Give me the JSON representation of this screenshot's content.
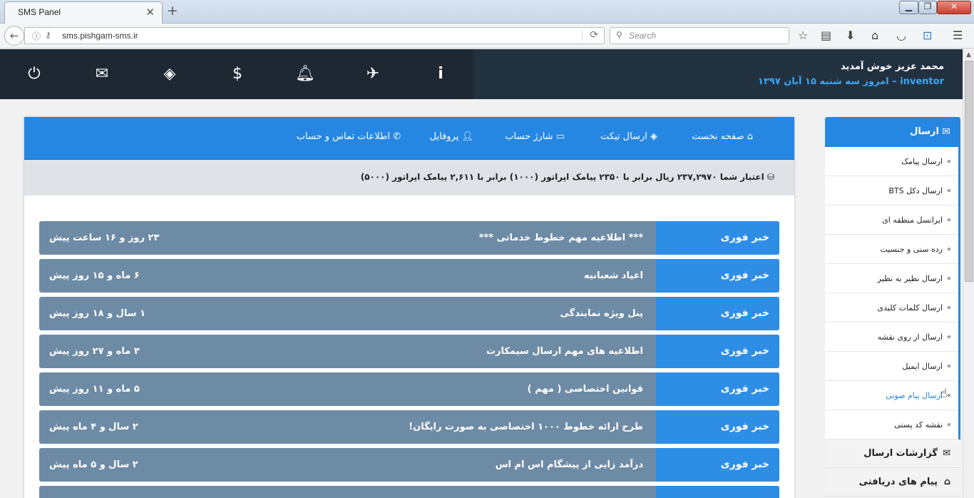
{
  "browser": {
    "tab_title": "SMS Panel",
    "tab_close": "✕",
    "new_tab": "+",
    "url": "sms.pishgam-sms.ir",
    "search_placeholder": "Search"
  },
  "header": {
    "welcome": "محمد عزیز خوش آمدید",
    "username": "inventor",
    "separator": " – ",
    "date_line": "امروز سه شنبه ۱۵ آبان ۱۳۹۷",
    "icons": [
      "power-icon",
      "envelope-icon",
      "ticket-icon",
      "dollar-icon",
      "bell-icon",
      "paper-plane-icon",
      "info-icon"
    ]
  },
  "topnav": {
    "home": "صفحه نخست",
    "send_ticket": "ارسال تیکت",
    "charge": "شارژ حساب",
    "profile": "پروفایل",
    "contact": "اطلاعات تماس و حساب"
  },
  "credit": {
    "text": "اعتبار شما ۲۳۷,۲۹۷۰ ریال برابر با ۲۳۵۰ پیامک اپراتور (۱۰۰۰) برابر با ۲,۶۱۱ پیامک اپراتور (۵۰۰۰)"
  },
  "news": [
    {
      "label": "خبر فوری",
      "title": "*** اطلاعیه مهم خطوط خدماتی ***",
      "time": "۲۳ روز و ۱۶ ساعت پیش"
    },
    {
      "label": "خبر فوری",
      "title": "اعیاد شعبانیه",
      "time": "۶ ماه و ۱۵ روز پیش"
    },
    {
      "label": "خبر فوری",
      "title": "پنل ویژه نمایندگی",
      "time": "۱ سال و ۱۸ روز پیش"
    },
    {
      "label": "خبر فوری",
      "title": "اطلاعیه های مهم ارسال سیمکارت",
      "time": "۳ ماه و ۲۷ روز پیش"
    },
    {
      "label": "خبر فوری",
      "title": "قوانین اختصاصی ( مهم )",
      "time": "۵ ماه و ۱۱ روز پیش"
    },
    {
      "label": "خبر فوری",
      "title": "طرح ارائه خطوط ۱۰۰۰ اختصاصی به صورت رایگان!",
      "time": "۲ سال و ۴ ماه پیش"
    },
    {
      "label": "خبر فوری",
      "title": "درآمد زایی از پیشگام اس ام اس",
      "time": "۲ سال و ۵ ماه پیش"
    }
  ],
  "sidebar": {
    "head": "ارسال",
    "items": [
      "ارسال پیامک",
      "ارسال دکل BTS",
      "ایرانسل منطقه ای",
      "رده سنی و جنسیت",
      "ارسال نظیر به نظیر",
      "ارسال کلمات کلیدی",
      "ارسال از روی نقشه",
      "ارسال ایمیل",
      "ارسال پیام صوتی",
      "نقشه کد پستی"
    ],
    "active_index": 8,
    "sections": [
      "گزارشات ارسال",
      "پیام های دریافتی"
    ]
  },
  "colors": {
    "accent": "#2687e2",
    "header_bg": "#1e2833",
    "news_bg": "#6e8ba5"
  }
}
